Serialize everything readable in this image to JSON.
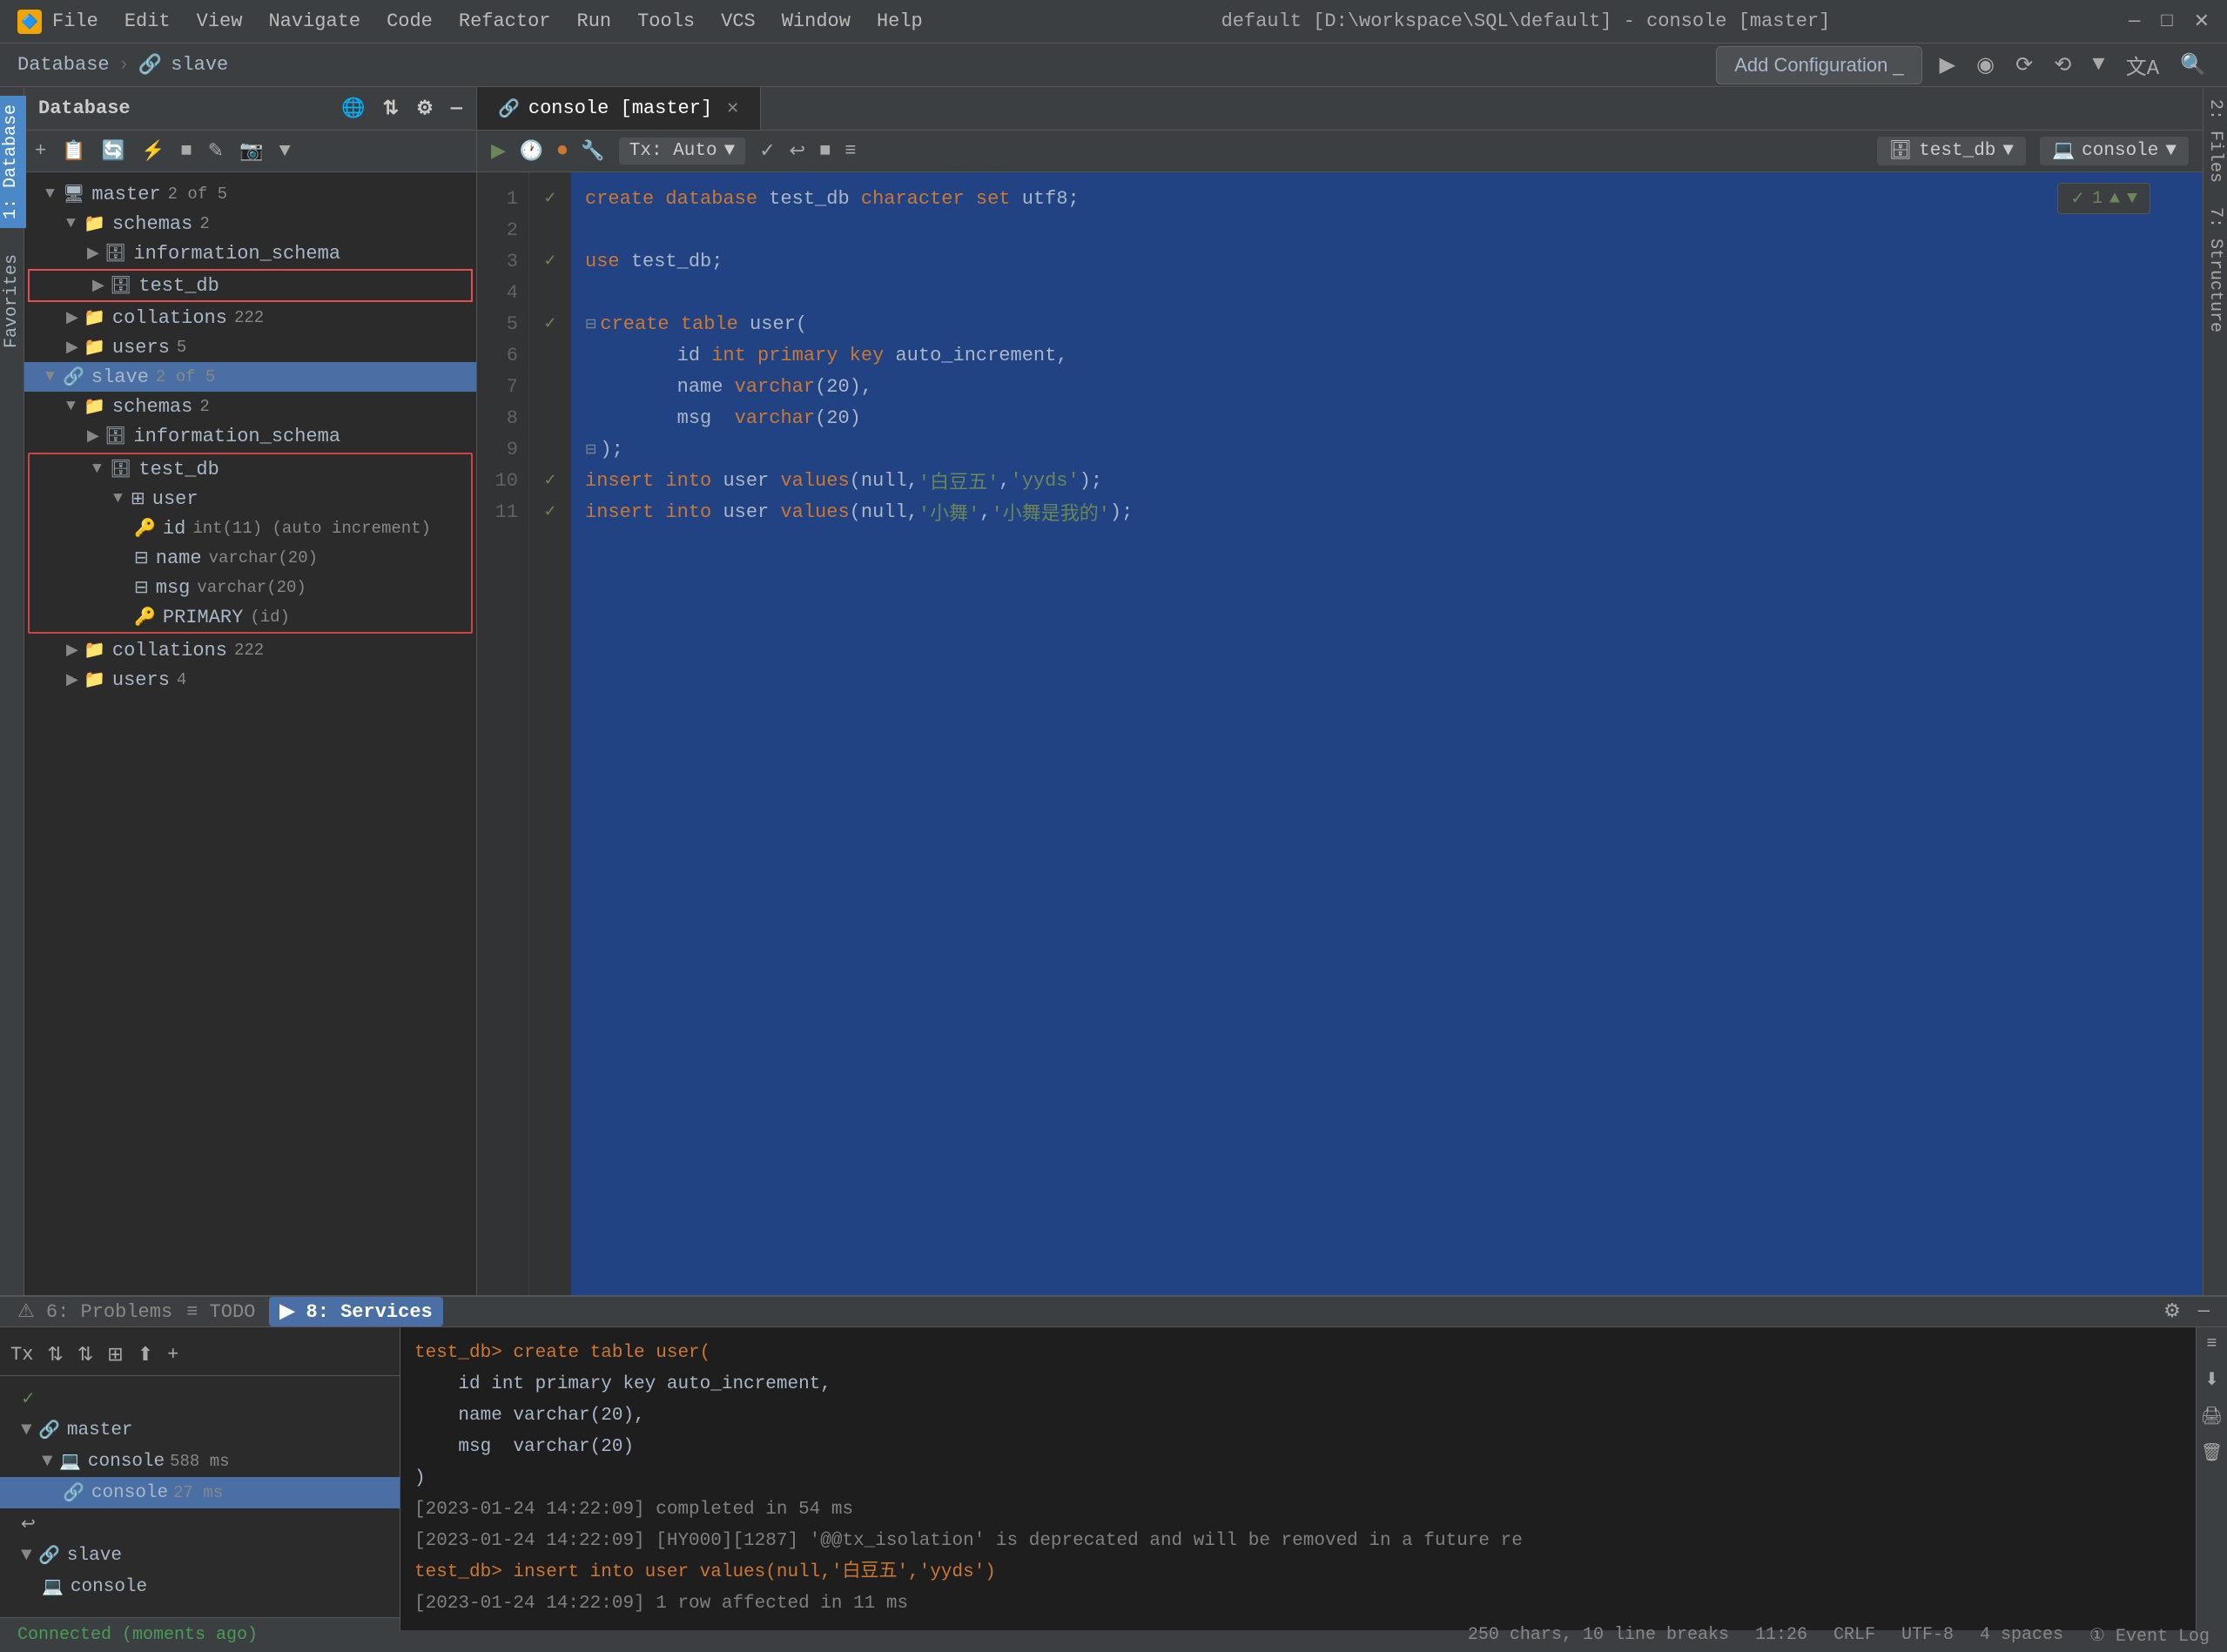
{
  "titlebar": {
    "logo": "🔷",
    "menu_items": [
      "File",
      "Edit",
      "View",
      "Navigate",
      "Code",
      "Refactor",
      "Run",
      "Tools",
      "VCS",
      "Window",
      "Help"
    ],
    "title": "default [D:\\workspace\\SQL\\default] - console [master]",
    "controls": [
      "—",
      "□",
      "✕"
    ]
  },
  "breadcrumb": {
    "items": [
      "Database",
      "slave"
    ],
    "icon": "🔗"
  },
  "toolbar": {
    "add_config_label": "Add Configuration _",
    "run_icon": "▶",
    "search_icon": "🔍",
    "translate_icon": "文A"
  },
  "db_panel": {
    "title": "Database",
    "header_icons": [
      "🌐",
      "⇅",
      "⚙",
      "—"
    ],
    "toolbar_icons": [
      "+",
      "📋",
      "🔄",
      "⚡",
      "■",
      "✎",
      "📷",
      "▼"
    ],
    "tree": {
      "master": {
        "label": "master",
        "badge": "2 of 5",
        "children": {
          "schemas": {
            "label": "schemas",
            "count": "2"
          },
          "information_schema": {
            "label": "information_schema"
          },
          "test_db": {
            "label": "test_db",
            "highlighted": true
          },
          "collations": {
            "label": "collations",
            "count": "222"
          },
          "users": {
            "label": "users",
            "count": "5"
          }
        }
      },
      "slave": {
        "label": "slave",
        "badge": "2 of 5",
        "selected": true,
        "children": {
          "schemas": {
            "label": "schemas",
            "count": "2"
          },
          "information_schema": {
            "label": "information_schema"
          },
          "test_db": {
            "label": "test_db",
            "red_border": true,
            "children": {
              "user": {
                "label": "user",
                "children": {
                  "id": {
                    "label": "id",
                    "type": "int(11) (auto increment)"
                  },
                  "name": {
                    "label": "name",
                    "type": "varchar(20)"
                  },
                  "msg": {
                    "label": "msg",
                    "type": "varchar(20)"
                  },
                  "PRIMARY": {
                    "label": "PRIMARY",
                    "type": "(id)"
                  }
                }
              }
            }
          },
          "collations": {
            "label": "collations",
            "count": "222"
          },
          "users": {
            "label": "users",
            "count": "4"
          }
        }
      }
    }
  },
  "editor": {
    "tab_label": "console [master]",
    "toolbar": {
      "run": "▶",
      "history": "🕐",
      "breakpoint": "⏺",
      "tools": "🔧",
      "tx_label": "Tx: Auto",
      "checkmark": "✓",
      "undo": "↩",
      "stop": "■",
      "format": "≡",
      "db_label": "test_db",
      "console_label": "console"
    },
    "check_badge": "✓ 1 ▲ ▼",
    "lines": [
      {
        "num": 1,
        "check": "✓",
        "code": "create database test_db character set utf8;"
      },
      {
        "num": 2,
        "check": "",
        "code": ""
      },
      {
        "num": 3,
        "check": "✓",
        "code": "use test_db;"
      },
      {
        "num": 4,
        "check": "",
        "code": ""
      },
      {
        "num": 5,
        "check": "✓",
        "code": "create table user(",
        "fold": true
      },
      {
        "num": 6,
        "check": "",
        "code": "    id int primary key auto_increment,"
      },
      {
        "num": 7,
        "check": "",
        "code": "    name varchar(20),"
      },
      {
        "num": 8,
        "check": "",
        "code": "    msg  varchar(20)"
      },
      {
        "num": 9,
        "check": "",
        "code": ");"
      },
      {
        "num": 10,
        "check": "✓",
        "code": "insert into user values(null,'白豆五','yyds');"
      },
      {
        "num": 11,
        "check": "✓",
        "code": "insert into user values(null,'小舞','小舞是我的');"
      }
    ]
  },
  "services": {
    "title": "Services",
    "toolbar_icons": [
      "Tx",
      "⇅",
      "⇅",
      "⊞",
      "⬆",
      "+"
    ],
    "tree": {
      "master": {
        "label": "master",
        "children": {
          "console_588": {
            "label": "console",
            "badge": "588 ms"
          },
          "console_27": {
            "label": "console",
            "badge": "27 ms",
            "selected": true
          }
        }
      },
      "slave": {
        "label": "slave",
        "children": {
          "console": {
            "label": "console"
          }
        }
      }
    }
  },
  "console_output": {
    "lines": [
      {
        "type": "orange",
        "text": "test_db> create table user("
      },
      {
        "type": "white",
        "text": "    id int primary key auto_increment,"
      },
      {
        "type": "white",
        "text": "    name varchar(20),"
      },
      {
        "type": "white",
        "text": "    msg  varchar(20)"
      },
      {
        "type": "white",
        "text": ")"
      },
      {
        "type": "gray",
        "text": "[2023-01-24 14:22:09] completed in 54 ms"
      },
      {
        "type": "gray",
        "text": "[2023-01-24 14:22:09] [HY000][1287] '@@tx_isolation' is deprecated and will be removed in a future re"
      },
      {
        "type": "orange",
        "text": "test_db> insert into user values(null,'白豆五','yyds')"
      },
      {
        "type": "gray",
        "text": "[2023-01-24 14:22:09] 1 row affected in 11 ms"
      }
    ]
  },
  "status_bar": {
    "connection": "Connected (moments ago)",
    "chars": "250 chars, 10 line breaks",
    "position": "11:26",
    "line_ending": "CRLF",
    "encoding": "UTF-8",
    "indent": "4 spaces",
    "problems": "⚠ 6: Problems",
    "todo": "≡ TODO",
    "services": "▶ 8: Services",
    "event_log": "① Event Log"
  },
  "right_vtabs": [
    "Files",
    "Structure"
  ]
}
